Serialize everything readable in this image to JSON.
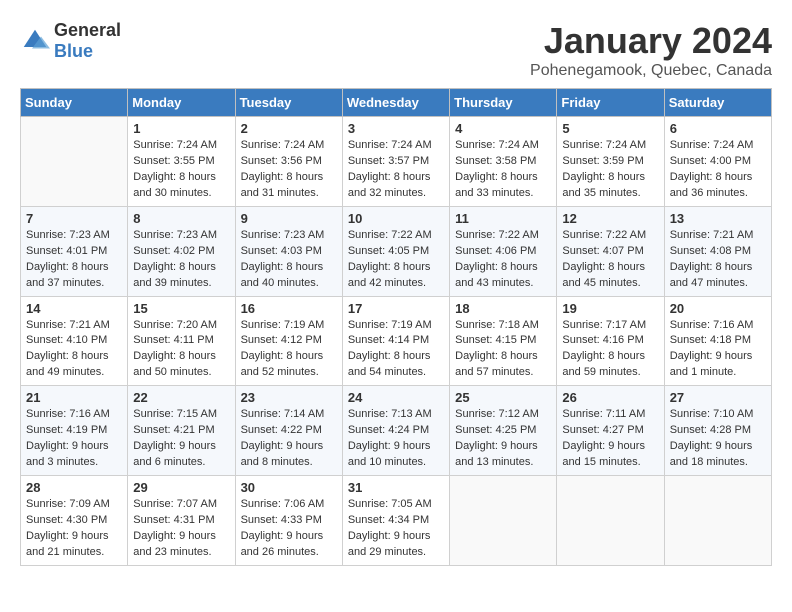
{
  "header": {
    "logo_general": "General",
    "logo_blue": "Blue",
    "month_title": "January 2024",
    "location": "Pohenegamook, Quebec, Canada"
  },
  "days_of_week": [
    "Sunday",
    "Monday",
    "Tuesday",
    "Wednesday",
    "Thursday",
    "Friday",
    "Saturday"
  ],
  "weeks": [
    [
      {
        "day": "",
        "content": ""
      },
      {
        "day": "1",
        "content": "Sunrise: 7:24 AM\nSunset: 3:55 PM\nDaylight: 8 hours\nand 30 minutes."
      },
      {
        "day": "2",
        "content": "Sunrise: 7:24 AM\nSunset: 3:56 PM\nDaylight: 8 hours\nand 31 minutes."
      },
      {
        "day": "3",
        "content": "Sunrise: 7:24 AM\nSunset: 3:57 PM\nDaylight: 8 hours\nand 32 minutes."
      },
      {
        "day": "4",
        "content": "Sunrise: 7:24 AM\nSunset: 3:58 PM\nDaylight: 8 hours\nand 33 minutes."
      },
      {
        "day": "5",
        "content": "Sunrise: 7:24 AM\nSunset: 3:59 PM\nDaylight: 8 hours\nand 35 minutes."
      },
      {
        "day": "6",
        "content": "Sunrise: 7:24 AM\nSunset: 4:00 PM\nDaylight: 8 hours\nand 36 minutes."
      }
    ],
    [
      {
        "day": "7",
        "content": "Sunrise: 7:23 AM\nSunset: 4:01 PM\nDaylight: 8 hours\nand 37 minutes."
      },
      {
        "day": "8",
        "content": "Sunrise: 7:23 AM\nSunset: 4:02 PM\nDaylight: 8 hours\nand 39 minutes."
      },
      {
        "day": "9",
        "content": "Sunrise: 7:23 AM\nSunset: 4:03 PM\nDaylight: 8 hours\nand 40 minutes."
      },
      {
        "day": "10",
        "content": "Sunrise: 7:22 AM\nSunset: 4:05 PM\nDaylight: 8 hours\nand 42 minutes."
      },
      {
        "day": "11",
        "content": "Sunrise: 7:22 AM\nSunset: 4:06 PM\nDaylight: 8 hours\nand 43 minutes."
      },
      {
        "day": "12",
        "content": "Sunrise: 7:22 AM\nSunset: 4:07 PM\nDaylight: 8 hours\nand 45 minutes."
      },
      {
        "day": "13",
        "content": "Sunrise: 7:21 AM\nSunset: 4:08 PM\nDaylight: 8 hours\nand 47 minutes."
      }
    ],
    [
      {
        "day": "14",
        "content": "Sunrise: 7:21 AM\nSunset: 4:10 PM\nDaylight: 8 hours\nand 49 minutes."
      },
      {
        "day": "15",
        "content": "Sunrise: 7:20 AM\nSunset: 4:11 PM\nDaylight: 8 hours\nand 50 minutes."
      },
      {
        "day": "16",
        "content": "Sunrise: 7:19 AM\nSunset: 4:12 PM\nDaylight: 8 hours\nand 52 minutes."
      },
      {
        "day": "17",
        "content": "Sunrise: 7:19 AM\nSunset: 4:14 PM\nDaylight: 8 hours\nand 54 minutes."
      },
      {
        "day": "18",
        "content": "Sunrise: 7:18 AM\nSunset: 4:15 PM\nDaylight: 8 hours\nand 57 minutes."
      },
      {
        "day": "19",
        "content": "Sunrise: 7:17 AM\nSunset: 4:16 PM\nDaylight: 8 hours\nand 59 minutes."
      },
      {
        "day": "20",
        "content": "Sunrise: 7:16 AM\nSunset: 4:18 PM\nDaylight: 9 hours\nand 1 minute."
      }
    ],
    [
      {
        "day": "21",
        "content": "Sunrise: 7:16 AM\nSunset: 4:19 PM\nDaylight: 9 hours\nand 3 minutes."
      },
      {
        "day": "22",
        "content": "Sunrise: 7:15 AM\nSunset: 4:21 PM\nDaylight: 9 hours\nand 6 minutes."
      },
      {
        "day": "23",
        "content": "Sunrise: 7:14 AM\nSunset: 4:22 PM\nDaylight: 9 hours\nand 8 minutes."
      },
      {
        "day": "24",
        "content": "Sunrise: 7:13 AM\nSunset: 4:24 PM\nDaylight: 9 hours\nand 10 minutes."
      },
      {
        "day": "25",
        "content": "Sunrise: 7:12 AM\nSunset: 4:25 PM\nDaylight: 9 hours\nand 13 minutes."
      },
      {
        "day": "26",
        "content": "Sunrise: 7:11 AM\nSunset: 4:27 PM\nDaylight: 9 hours\nand 15 minutes."
      },
      {
        "day": "27",
        "content": "Sunrise: 7:10 AM\nSunset: 4:28 PM\nDaylight: 9 hours\nand 18 minutes."
      }
    ],
    [
      {
        "day": "28",
        "content": "Sunrise: 7:09 AM\nSunset: 4:30 PM\nDaylight: 9 hours\nand 21 minutes."
      },
      {
        "day": "29",
        "content": "Sunrise: 7:07 AM\nSunset: 4:31 PM\nDaylight: 9 hours\nand 23 minutes."
      },
      {
        "day": "30",
        "content": "Sunrise: 7:06 AM\nSunset: 4:33 PM\nDaylight: 9 hours\nand 26 minutes."
      },
      {
        "day": "31",
        "content": "Sunrise: 7:05 AM\nSunset: 4:34 PM\nDaylight: 9 hours\nand 29 minutes."
      },
      {
        "day": "",
        "content": ""
      },
      {
        "day": "",
        "content": ""
      },
      {
        "day": "",
        "content": ""
      }
    ]
  ]
}
